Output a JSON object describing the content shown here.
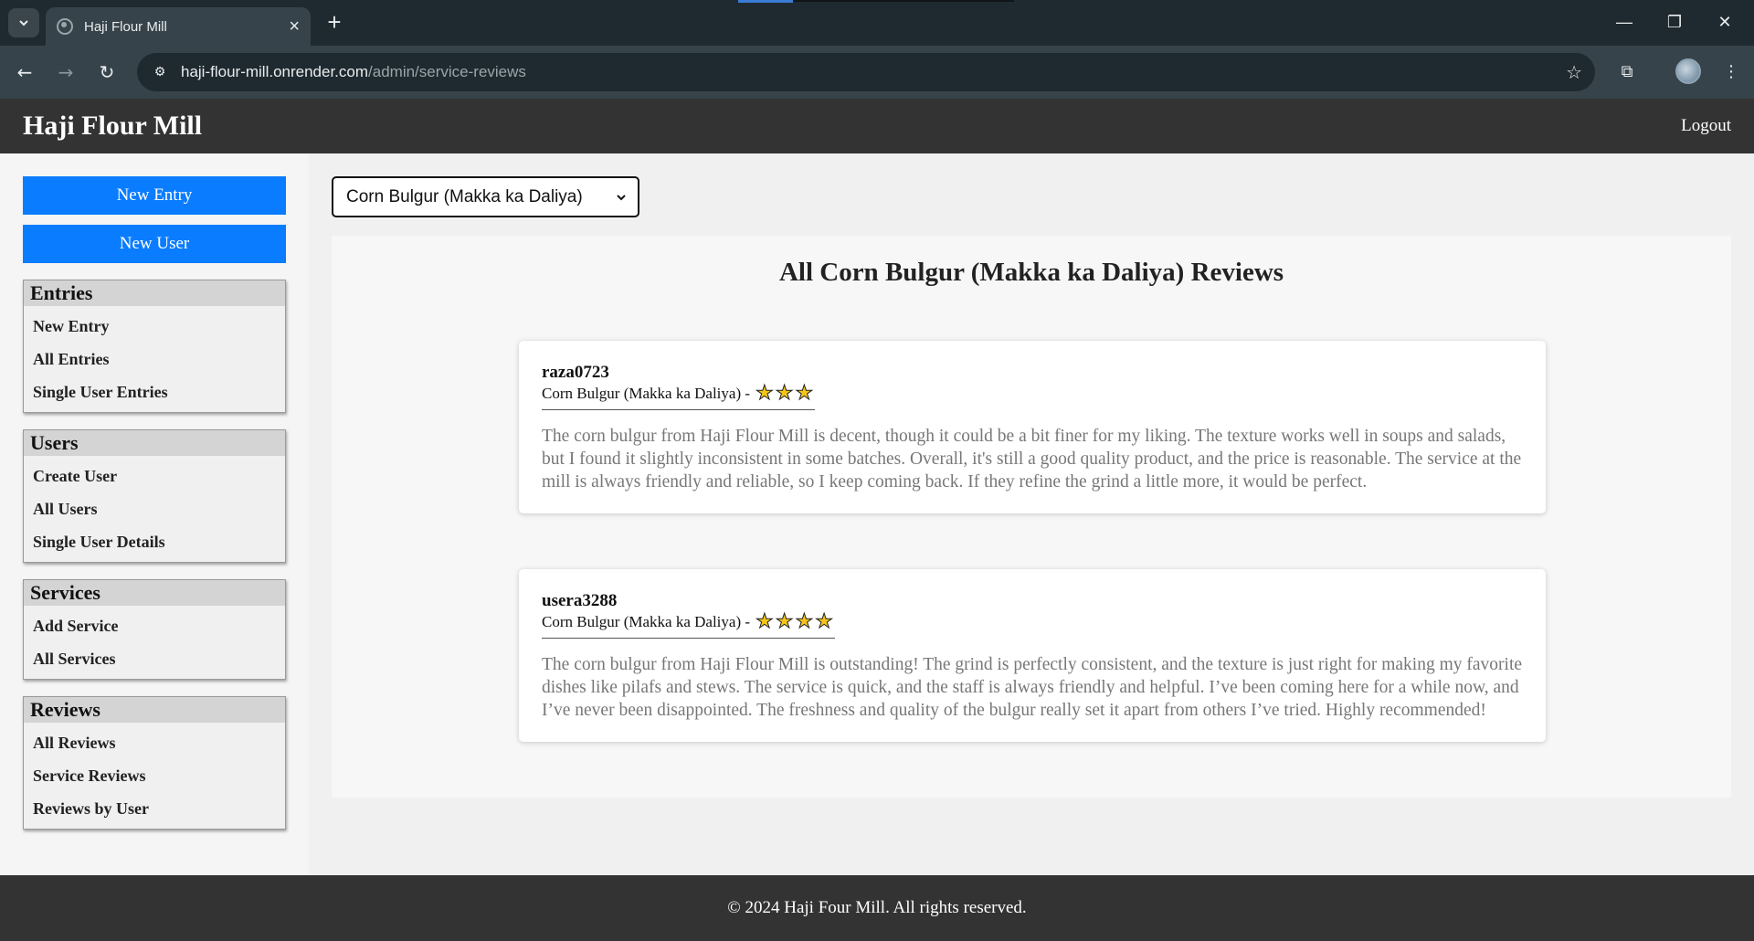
{
  "browser": {
    "tab_title": "Haji Flour Mill",
    "url_host": "haji-flour-mill.onrender.com",
    "url_path": "/admin/service-reviews"
  },
  "header": {
    "title": "Haji Flour Mill",
    "logout": "Logout"
  },
  "sidebar": {
    "buttons": [
      "New Entry",
      "New User"
    ],
    "sections": [
      {
        "title": "Entries",
        "links": [
          "New Entry",
          "All Entries",
          "Single User Entries"
        ]
      },
      {
        "title": "Users",
        "links": [
          "Create User",
          "All Users",
          "Single User Details"
        ]
      },
      {
        "title": "Services",
        "links": [
          "Add Service",
          "All Services"
        ]
      },
      {
        "title": "Reviews",
        "links": [
          "All Reviews",
          "Service Reviews",
          "Reviews by User"
        ]
      }
    ]
  },
  "main": {
    "service_select": "Corn Bulgur (Makka ka Daliya)",
    "title": "All Corn Bulgur (Makka ka Daliya) Reviews",
    "reviews": [
      {
        "user": "raza0723",
        "service": "Corn Bulgur (Makka ka Daliya) -",
        "rating": 3,
        "text": "The corn bulgur from Haji Flour Mill is decent, though it could be a bit finer for my liking. The texture works well in soups and salads, but I found it slightly inconsistent in some batches. Overall, it's still a good quality product, and the price is reasonable. The service at the mill is always friendly and reliable, so I keep coming back. If they refine the grind a little more, it would be perfect."
      },
      {
        "user": "usera3288",
        "service": "Corn Bulgur (Makka ka Daliya) -",
        "rating": 4,
        "text": "The corn bulgur from Haji Flour Mill is outstanding! The grind is perfectly consistent, and the texture is just right for making my favorite dishes like pilafs and stews. The service is quick, and the staff is always friendly and helpful. I’ve been coming here for a while now, and I’ve never been disappointed. The freshness and quality of the bulgur really set it apart from others I’ve tried. Highly recommended!"
      }
    ]
  },
  "footer": {
    "text": "© 2024 Haji Four Mill. All rights reserved."
  },
  "colors": {
    "header_bg": "#333333",
    "button_blue": "#0a7cff",
    "star": "#f5c518"
  }
}
